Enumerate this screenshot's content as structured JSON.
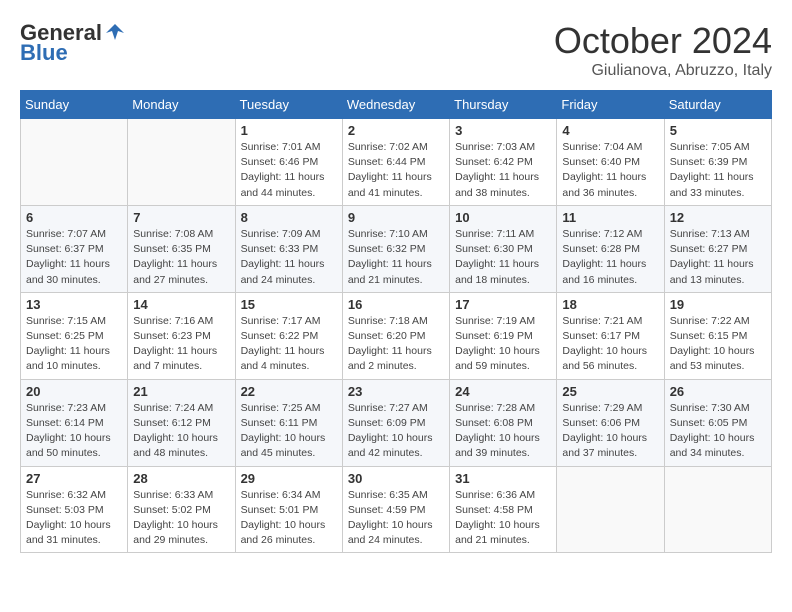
{
  "logo": {
    "general": "General",
    "blue": "Blue",
    "icon": "▶"
  },
  "title": "October 2024",
  "location": "Giulianova, Abruzzo, Italy",
  "weekdays": [
    "Sunday",
    "Monday",
    "Tuesday",
    "Wednesday",
    "Thursday",
    "Friday",
    "Saturday"
  ],
  "weeks": [
    [
      {
        "day": "",
        "info": ""
      },
      {
        "day": "",
        "info": ""
      },
      {
        "day": "1",
        "info": "Sunrise: 7:01 AM\nSunset: 6:46 PM\nDaylight: 11 hours and 44 minutes."
      },
      {
        "day": "2",
        "info": "Sunrise: 7:02 AM\nSunset: 6:44 PM\nDaylight: 11 hours and 41 minutes."
      },
      {
        "day": "3",
        "info": "Sunrise: 7:03 AM\nSunset: 6:42 PM\nDaylight: 11 hours and 38 minutes."
      },
      {
        "day": "4",
        "info": "Sunrise: 7:04 AM\nSunset: 6:40 PM\nDaylight: 11 hours and 36 minutes."
      },
      {
        "day": "5",
        "info": "Sunrise: 7:05 AM\nSunset: 6:39 PM\nDaylight: 11 hours and 33 minutes."
      }
    ],
    [
      {
        "day": "6",
        "info": "Sunrise: 7:07 AM\nSunset: 6:37 PM\nDaylight: 11 hours and 30 minutes."
      },
      {
        "day": "7",
        "info": "Sunrise: 7:08 AM\nSunset: 6:35 PM\nDaylight: 11 hours and 27 minutes."
      },
      {
        "day": "8",
        "info": "Sunrise: 7:09 AM\nSunset: 6:33 PM\nDaylight: 11 hours and 24 minutes."
      },
      {
        "day": "9",
        "info": "Sunrise: 7:10 AM\nSunset: 6:32 PM\nDaylight: 11 hours and 21 minutes."
      },
      {
        "day": "10",
        "info": "Sunrise: 7:11 AM\nSunset: 6:30 PM\nDaylight: 11 hours and 18 minutes."
      },
      {
        "day": "11",
        "info": "Sunrise: 7:12 AM\nSunset: 6:28 PM\nDaylight: 11 hours and 16 minutes."
      },
      {
        "day": "12",
        "info": "Sunrise: 7:13 AM\nSunset: 6:27 PM\nDaylight: 11 hours and 13 minutes."
      }
    ],
    [
      {
        "day": "13",
        "info": "Sunrise: 7:15 AM\nSunset: 6:25 PM\nDaylight: 11 hours and 10 minutes."
      },
      {
        "day": "14",
        "info": "Sunrise: 7:16 AM\nSunset: 6:23 PM\nDaylight: 11 hours and 7 minutes."
      },
      {
        "day": "15",
        "info": "Sunrise: 7:17 AM\nSunset: 6:22 PM\nDaylight: 11 hours and 4 minutes."
      },
      {
        "day": "16",
        "info": "Sunrise: 7:18 AM\nSunset: 6:20 PM\nDaylight: 11 hours and 2 minutes."
      },
      {
        "day": "17",
        "info": "Sunrise: 7:19 AM\nSunset: 6:19 PM\nDaylight: 10 hours and 59 minutes."
      },
      {
        "day": "18",
        "info": "Sunrise: 7:21 AM\nSunset: 6:17 PM\nDaylight: 10 hours and 56 minutes."
      },
      {
        "day": "19",
        "info": "Sunrise: 7:22 AM\nSunset: 6:15 PM\nDaylight: 10 hours and 53 minutes."
      }
    ],
    [
      {
        "day": "20",
        "info": "Sunrise: 7:23 AM\nSunset: 6:14 PM\nDaylight: 10 hours and 50 minutes."
      },
      {
        "day": "21",
        "info": "Sunrise: 7:24 AM\nSunset: 6:12 PM\nDaylight: 10 hours and 48 minutes."
      },
      {
        "day": "22",
        "info": "Sunrise: 7:25 AM\nSunset: 6:11 PM\nDaylight: 10 hours and 45 minutes."
      },
      {
        "day": "23",
        "info": "Sunrise: 7:27 AM\nSunset: 6:09 PM\nDaylight: 10 hours and 42 minutes."
      },
      {
        "day": "24",
        "info": "Sunrise: 7:28 AM\nSunset: 6:08 PM\nDaylight: 10 hours and 39 minutes."
      },
      {
        "day": "25",
        "info": "Sunrise: 7:29 AM\nSunset: 6:06 PM\nDaylight: 10 hours and 37 minutes."
      },
      {
        "day": "26",
        "info": "Sunrise: 7:30 AM\nSunset: 6:05 PM\nDaylight: 10 hours and 34 minutes."
      }
    ],
    [
      {
        "day": "27",
        "info": "Sunrise: 6:32 AM\nSunset: 5:03 PM\nDaylight: 10 hours and 31 minutes."
      },
      {
        "day": "28",
        "info": "Sunrise: 6:33 AM\nSunset: 5:02 PM\nDaylight: 10 hours and 29 minutes."
      },
      {
        "day": "29",
        "info": "Sunrise: 6:34 AM\nSunset: 5:01 PM\nDaylight: 10 hours and 26 minutes."
      },
      {
        "day": "30",
        "info": "Sunrise: 6:35 AM\nSunset: 4:59 PM\nDaylight: 10 hours and 24 minutes."
      },
      {
        "day": "31",
        "info": "Sunrise: 6:36 AM\nSunset: 4:58 PM\nDaylight: 10 hours and 21 minutes."
      },
      {
        "day": "",
        "info": ""
      },
      {
        "day": "",
        "info": ""
      }
    ]
  ]
}
